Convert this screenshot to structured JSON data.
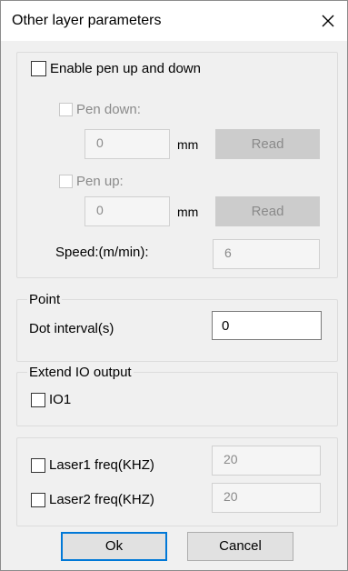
{
  "dialog": {
    "title": "Other layer parameters",
    "close_icon": "close-icon"
  },
  "pen_group": {
    "enable_label": "Enable pen up and down",
    "pen_down_label": "Pen down:",
    "pen_down_value": "0",
    "pen_down_unit": "mm",
    "pen_down_read": "Read",
    "pen_up_label": "Pen up:",
    "pen_up_value": "0",
    "pen_up_unit": "mm",
    "pen_up_read": "Read",
    "speed_label": "Speed:(m/min):",
    "speed_value": "6"
  },
  "point_group": {
    "title": "Point",
    "dot_interval_label": "Dot interval(s)",
    "dot_interval_value": "0"
  },
  "io_group": {
    "title": "Extend IO output",
    "io1_label": "IO1"
  },
  "laser_group": {
    "laser1_label": "Laser1 freq(KHZ)",
    "laser1_value": "20",
    "laser2_label": "Laser2 freq(KHZ)",
    "laser2_value": "20"
  },
  "footer": {
    "ok_label": "Ok",
    "cancel_label": "Cancel"
  }
}
